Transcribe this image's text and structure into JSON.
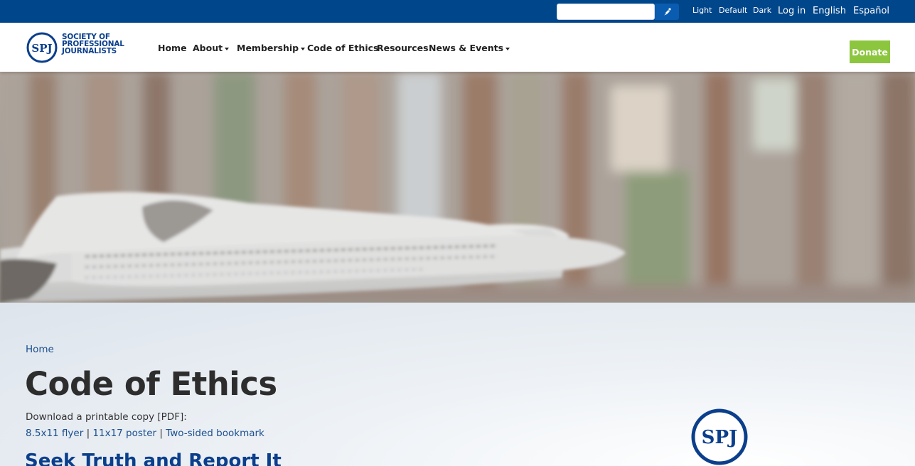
{
  "topbar": {
    "search_placeholder": "",
    "theme_light": "Light",
    "theme_default": "Default",
    "theme_dark": "Dark",
    "login": "Log in",
    "lang_english": "English",
    "lang_espanol": "Español",
    "search_icon": "pen-nib-icon"
  },
  "logo": {
    "line1": "SOCIETY OF",
    "line2": "PROFESSIONAL",
    "line3": "JOURNALISTS",
    "mark": "SPJ"
  },
  "nav": {
    "home": "Home",
    "about": "About",
    "membership": "Membership",
    "code_of_ethics": "Code of Ethics",
    "resources": "Resources",
    "news_events": "News & Events",
    "donate": "Donate"
  },
  "breadcrumb": {
    "home": "Home"
  },
  "page": {
    "title": "Code of Ethics",
    "download_label": "Download a printable copy [PDF]:",
    "links": [
      "8.5x11 flyer",
      "11x17 poster",
      "Two-sided bookmark"
    ],
    "separator": " | ",
    "section_heading": "Seek Truth and Report It"
  },
  "colors": {
    "topbar": "#00468b",
    "donate": "#8cc63f",
    "link": "#1a4f8f",
    "heading": "#0b3f8c"
  }
}
